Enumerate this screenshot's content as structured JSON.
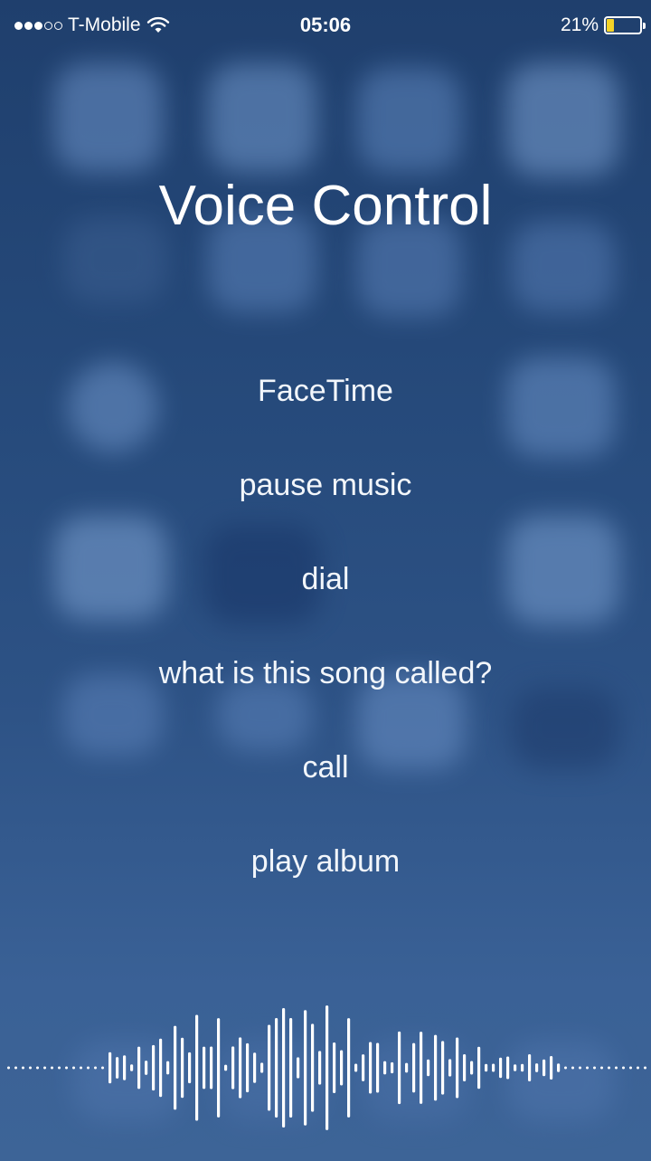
{
  "status_bar": {
    "signal_dots": [
      true,
      true,
      true,
      false,
      false
    ],
    "carrier": "T-Mobile",
    "wifi_icon": "wifi-icon",
    "time": "05:06",
    "battery_percent": "21%",
    "battery_level": 0.21,
    "battery_color": "#f5d327"
  },
  "title": "Voice Control",
  "commands": [
    {
      "label": "FaceTime"
    },
    {
      "label": "pause music"
    },
    {
      "label": "dial"
    },
    {
      "label": "what is this song called?"
    },
    {
      "label": "call"
    },
    {
      "label": "play album"
    }
  ],
  "colors": {
    "background_top": "#1f3f6d",
    "background_bottom": "#3d6497",
    "text": "#ffffff"
  }
}
